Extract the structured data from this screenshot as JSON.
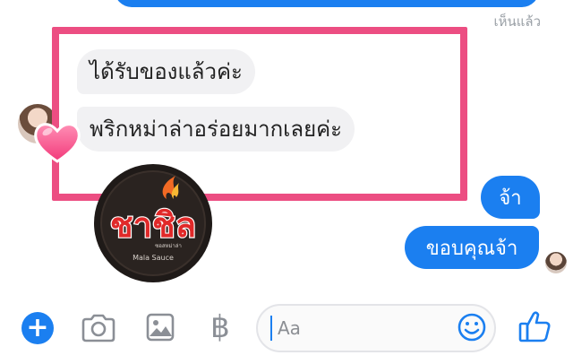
{
  "conversation": {
    "seen_label": "เห็นแล้ว",
    "received_messages": [
      {
        "text": "ได้รับของแล้วค่ะ"
      },
      {
        "text": "พริกหม่าล่าอร่อยมากเลยค่ะ"
      }
    ],
    "reaction_icon": "heart-icon",
    "sticker": {
      "brand": "ชาชิล",
      "tagline": "Mala Sauce",
      "subtext": "ซอสหม่าล่า"
    },
    "sent_messages": [
      {
        "text": "จ้า"
      },
      {
        "text": "ขอบคุณจ้า"
      }
    ]
  },
  "composer": {
    "placeholder": "Aa",
    "currency_symbol": "฿",
    "plus_symbol": "+"
  },
  "colors": {
    "accent": "#1b7ff0",
    "highlight": "#ec4e82",
    "received_bubble": "#f1f1f3",
    "icon_gray": "#8b8f96"
  }
}
